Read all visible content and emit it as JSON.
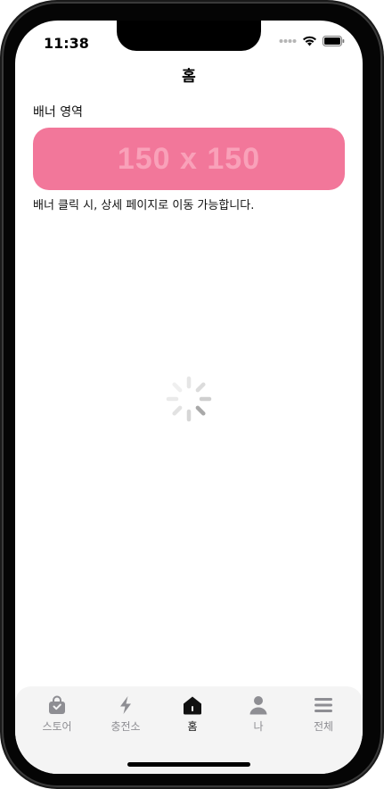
{
  "status_bar": {
    "time": "11:38",
    "icons": [
      "signal-dots-icon",
      "wifi-icon",
      "battery-icon"
    ]
  },
  "header": {
    "title": "홈"
  },
  "banner_section": {
    "label": "배너 영역",
    "placeholder_text": "150 x 150",
    "description": "배너 클릭 시, 상세 페이지로 이동 가능합니다.",
    "color": "#f2779a"
  },
  "loading": {
    "icon": "activity-spinner-icon"
  },
  "tabbar": {
    "active_index": 2,
    "items": [
      {
        "label": "스토어",
        "icon": "shopping-bag-icon"
      },
      {
        "label": "충전소",
        "icon": "lightning-bolt-icon"
      },
      {
        "label": "홈",
        "icon": "home-icon"
      },
      {
        "label": "나",
        "icon": "person-icon"
      },
      {
        "label": "전체",
        "icon": "menu-icon"
      }
    ]
  }
}
